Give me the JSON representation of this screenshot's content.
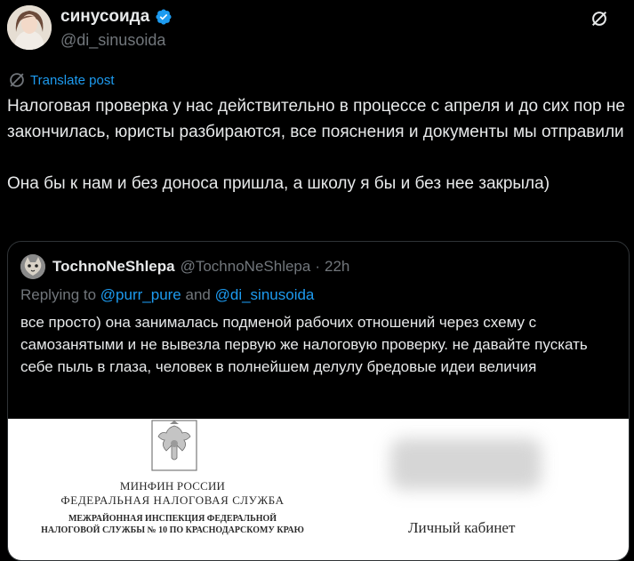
{
  "post": {
    "author": {
      "display_name": "синусоида",
      "handle": "@di_sinusoida",
      "verified": true,
      "verified_color": "#1d9bf0"
    },
    "translate_label": "Translate post",
    "text": "Налоговая проверка у нас действительно в процессе с апреля и до сих пор не закончилась, юристы разбираются, все пояснения и документы мы отправили\n\nОна бы к нам и без доноса пришла, а школу я бы и без нее закрыла)"
  },
  "quote": {
    "author": {
      "display_name": "TochnoNeShlepa",
      "handle": "@TochnoNeShlepa",
      "time": "22h"
    },
    "reply": {
      "prefix": "Replying to",
      "mention1": "@purr_pure",
      "joiner": "and",
      "mention2": "@di_sinusoida"
    },
    "text": "все просто) она занималась подменой рабочих отношений через схему с самозанятыми и не вывезла первую же налоговую проверку. не давайте пускать себе пыль в глаза, человек в полнейшем делулу бредовые идеи величия",
    "image": {
      "org_line1": "МИНФИН РОССИИ",
      "org_line2": "ФЕДЕРАЛЬНАЯ НАЛОГОВАЯ СЛУЖБА",
      "org_line3": "МЕЖРАЙОННАЯ ИНСПЕКЦИЯ ФЕДЕРАЛЬНОЙ НАЛОГОВОЙ СЛУЖБЫ № 10 ПО КРАСНОДАРСКОМУ КРАЮ",
      "cabinet_label": "Личный кабинет"
    }
  },
  "icons": {
    "verified": "verified-badge-icon",
    "grok": "grok-icon",
    "translate": "globe-icon"
  },
  "theme": {
    "background": "#000000",
    "text": "#e7e9ea",
    "secondary": "#71767b",
    "accent": "#1d9bf0",
    "border": "#2f3336"
  }
}
